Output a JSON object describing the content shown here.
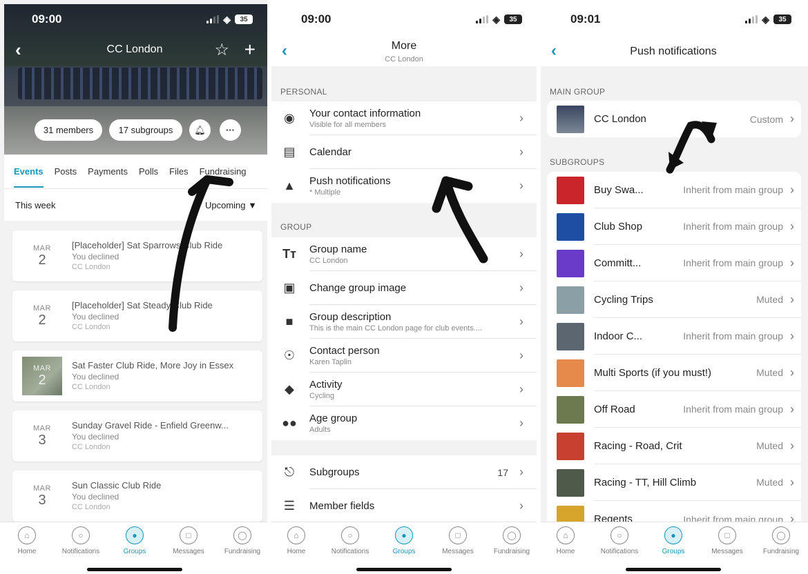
{
  "colors": {
    "accent": "#1a97b8",
    "background": "#f2f2f3",
    "annotation": "#111111"
  },
  "screen1": {
    "time": "09:00",
    "battery": "35",
    "title": "CC London",
    "chips": {
      "members": "31 members",
      "subgroups": "17 subgroups"
    },
    "tabs": [
      "Events",
      "Posts",
      "Payments",
      "Polls",
      "Files",
      "Fundraising"
    ],
    "filter": {
      "period": "This week",
      "mode": "Upcoming ▼"
    },
    "events": [
      {
        "month": "MAR",
        "day": "2",
        "title": "[Placeholder] Sat Sparrows Club Ride",
        "status": "You declined",
        "group": "CC London"
      },
      {
        "month": "MAR",
        "day": "2",
        "title": "[Placeholder] Sat Steady Club Ride",
        "status": "You declined",
        "group": "CC London"
      },
      {
        "month": "MAR",
        "day": "2",
        "title": "Sat Faster Club Ride, More Joy in Essex",
        "status": "You declined",
        "group": "CC London"
      },
      {
        "month": "MAR",
        "day": "3",
        "title": "Sunday Gravel Ride - Enfield Greenw...",
        "status": "You declined",
        "group": "CC London"
      },
      {
        "month": "MAR",
        "day": "3",
        "title": "Sun Classic Club Ride",
        "status": "You declined",
        "group": "CC London"
      }
    ]
  },
  "screen2": {
    "time": "09:00",
    "battery": "35",
    "title": "More",
    "subtitle": "CC London",
    "personal_label": "PERSONAL",
    "personal": [
      {
        "icon": "eye-icon",
        "label": "Your contact information",
        "sub": "Visible for all members"
      },
      {
        "icon": "calendar-icon",
        "label": "Calendar",
        "sub": ""
      },
      {
        "icon": "bell-icon",
        "label": "Push notifications",
        "sub": "* Multiple"
      }
    ],
    "group_label": "GROUP",
    "group": [
      {
        "icon": "text-icon",
        "label": "Group name",
        "sub": "CC London"
      },
      {
        "icon": "camera-icon",
        "label": "Change group image",
        "sub": ""
      },
      {
        "icon": "speech-bubble-icon",
        "label": "Group description",
        "sub": "This is the main CC London page for club events...."
      },
      {
        "icon": "person-icon",
        "label": "Contact person",
        "sub": "Karen Taplin"
      },
      {
        "icon": "tag-icon",
        "label": "Activity",
        "sub": "Cycling"
      },
      {
        "icon": "people-icon",
        "label": "Age group",
        "sub": "Adults"
      }
    ],
    "extra": [
      {
        "icon": "hierarchy-icon",
        "label": "Subgroups",
        "count": "17"
      },
      {
        "icon": "list-icon",
        "label": "Member fields",
        "count": ""
      }
    ]
  },
  "screen3": {
    "time": "09:01",
    "battery": "35",
    "title": "Push notifications",
    "main_label": "MAIN GROUP",
    "main": {
      "name": "CC London",
      "value": "Custom"
    },
    "sub_label": "SUBGROUPS",
    "subgroups": [
      {
        "name": "Buy Swa...",
        "value": "Inherit from main group",
        "color": "#c9252b"
      },
      {
        "name": "Club Shop",
        "value": "Inherit from main group",
        "color": "#1c4fa3"
      },
      {
        "name": "Committ...",
        "value": "Inherit from main group",
        "color": "#6a3bc8"
      },
      {
        "name": "Cycling Trips",
        "value": "Muted",
        "color": "#8aa0a6"
      },
      {
        "name": "Indoor C...",
        "value": "Inherit from main group",
        "color": "#5b6670"
      },
      {
        "name": "Multi Sports (if you must!)",
        "value": "Muted",
        "color": "#e58a4a"
      },
      {
        "name": "Off Road",
        "value": "Inherit from main group",
        "color": "#6d7a4f"
      },
      {
        "name": "Racing - Road, Crit",
        "value": "Muted",
        "color": "#c8402e"
      },
      {
        "name": "Racing - TT, Hill Climb",
        "value": "Muted",
        "color": "#4e5a4a"
      },
      {
        "name": "Regents",
        "value": "Inherit from main group",
        "color": "#d6a42a"
      }
    ]
  },
  "tabbar": [
    "Home",
    "Notifications",
    "Groups",
    "Messages",
    "Fundraising"
  ]
}
